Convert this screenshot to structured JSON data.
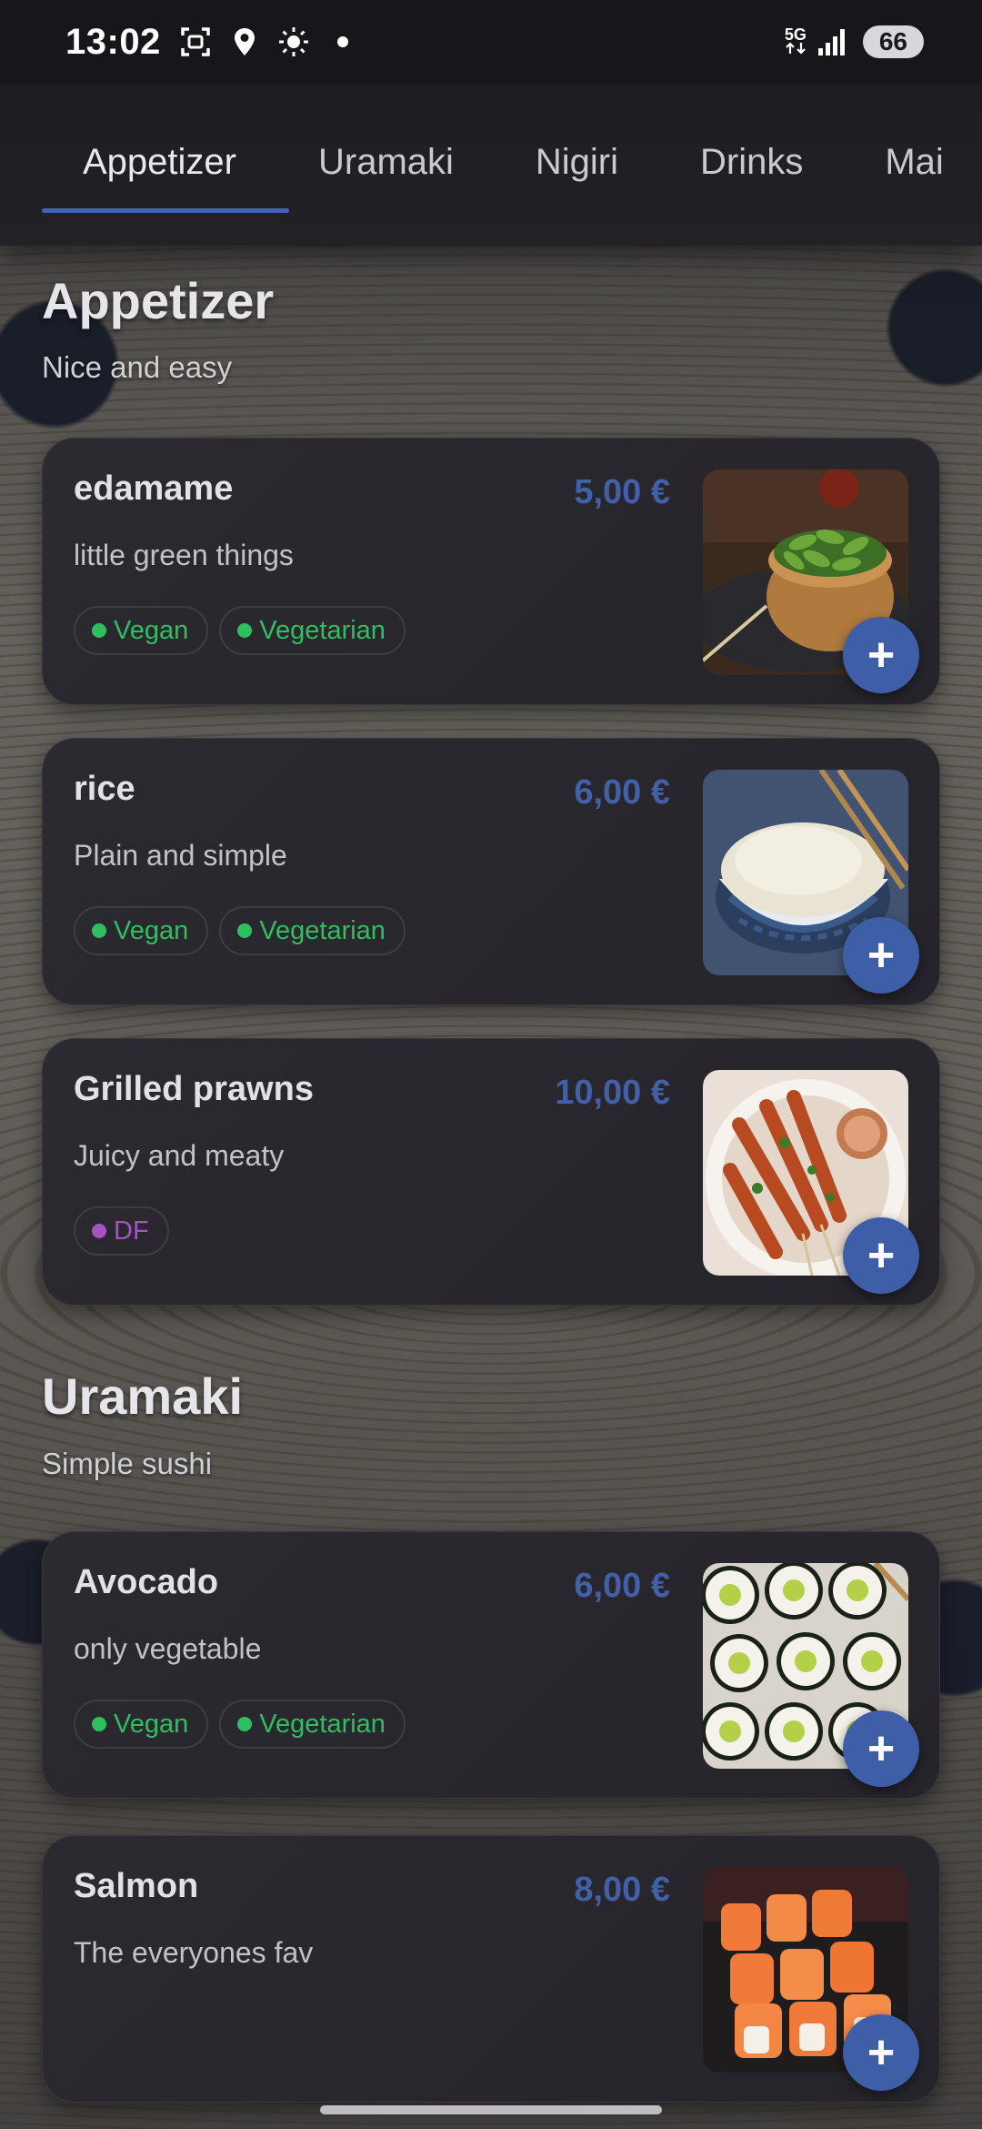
{
  "status_bar": {
    "time": "13:02",
    "network": "5G",
    "battery": "66"
  },
  "tabs": [
    {
      "label": "Appetizer",
      "active": true
    },
    {
      "label": "Uramaki",
      "active": false
    },
    {
      "label": "Nigiri",
      "active": false
    },
    {
      "label": "Drinks",
      "active": false
    },
    {
      "label": "Mai",
      "active": false
    }
  ],
  "sections": [
    {
      "title": "Appetizer",
      "subtitle": "Nice and easy",
      "items": [
        {
          "name": "edamame",
          "description": "little green things",
          "price": "5,00 €",
          "badges": [
            {
              "label": "Vegan",
              "color": "#2fbf60"
            },
            {
              "label": "Vegetarian",
              "color": "#2fbf60"
            }
          ],
          "image": "edamame-bowl-photo"
        },
        {
          "name": "rice",
          "description": "Plain and simple",
          "price": "6,00 €",
          "badges": [
            {
              "label": "Vegan",
              "color": "#2fbf60"
            },
            {
              "label": "Vegetarian",
              "color": "#2fbf60"
            }
          ],
          "image": "rice-bowl-photo"
        },
        {
          "name": "Grilled prawns",
          "description": "Juicy and meaty",
          "price": "10,00 €",
          "badges": [
            {
              "label": "DF",
              "color": "#a454c0"
            }
          ],
          "image": "grilled-prawns-photo"
        }
      ]
    },
    {
      "title": "Uramaki",
      "subtitle": "Simple sushi",
      "items": [
        {
          "name": "Avocado",
          "description": "only vegetable",
          "price": "6,00 €",
          "badges": [
            {
              "label": "Vegan",
              "color": "#2fbf60"
            },
            {
              "label": "Vegetarian",
              "color": "#2fbf60"
            }
          ],
          "image": "avocado-roll-photo"
        },
        {
          "name": "Salmon",
          "description": "The everyones fav",
          "price": "8,00 €",
          "badges": [],
          "image": "salmon-roll-photo"
        }
      ]
    }
  ],
  "add_button_label": "+",
  "colors": {
    "accent": "#3f5ea8",
    "price": "#4160a8",
    "vegan": "#2fbf60",
    "df": "#a454c0",
    "card": "#2a2930"
  }
}
